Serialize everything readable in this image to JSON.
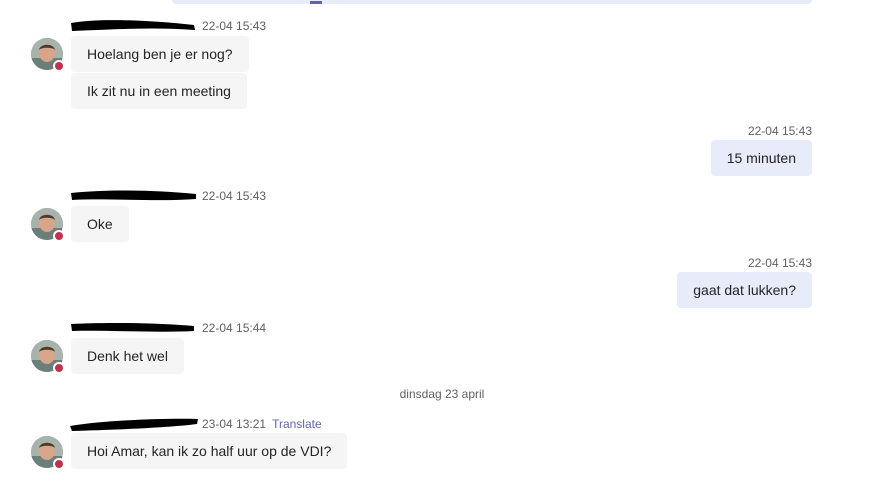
{
  "chat": {
    "groups": [
      {
        "sender": "",
        "time": "22-04 15:43",
        "messages": [
          "Hoelang ben je er nog?",
          "Ik zit nu in een meeting"
        ]
      },
      {
        "self": true,
        "time": "22-04 15:43",
        "messages": [
          "15 minuten"
        ]
      },
      {
        "sender": "",
        "time": "22-04 15:43",
        "messages": [
          "Oke"
        ]
      },
      {
        "self": true,
        "time": "22-04 15:43",
        "messages": [
          "gaat dat lukken?"
        ]
      },
      {
        "sender": "",
        "time": "22-04 15:44",
        "messages": [
          "Denk het wel"
        ]
      },
      {
        "sender": "",
        "time": "23-04 13:21",
        "translate": "Translate",
        "messages": [
          "Hoi Amar, kan ik zo half uur op de VDI?"
        ]
      }
    ],
    "date_divider": "dinsdag 23 april"
  },
  "colors": {
    "incoming_bubble": "#f5f5f5",
    "outgoing_bubble": "#e8ebfa",
    "accent": "#6264a7",
    "presence_busy": "#c4314b"
  }
}
